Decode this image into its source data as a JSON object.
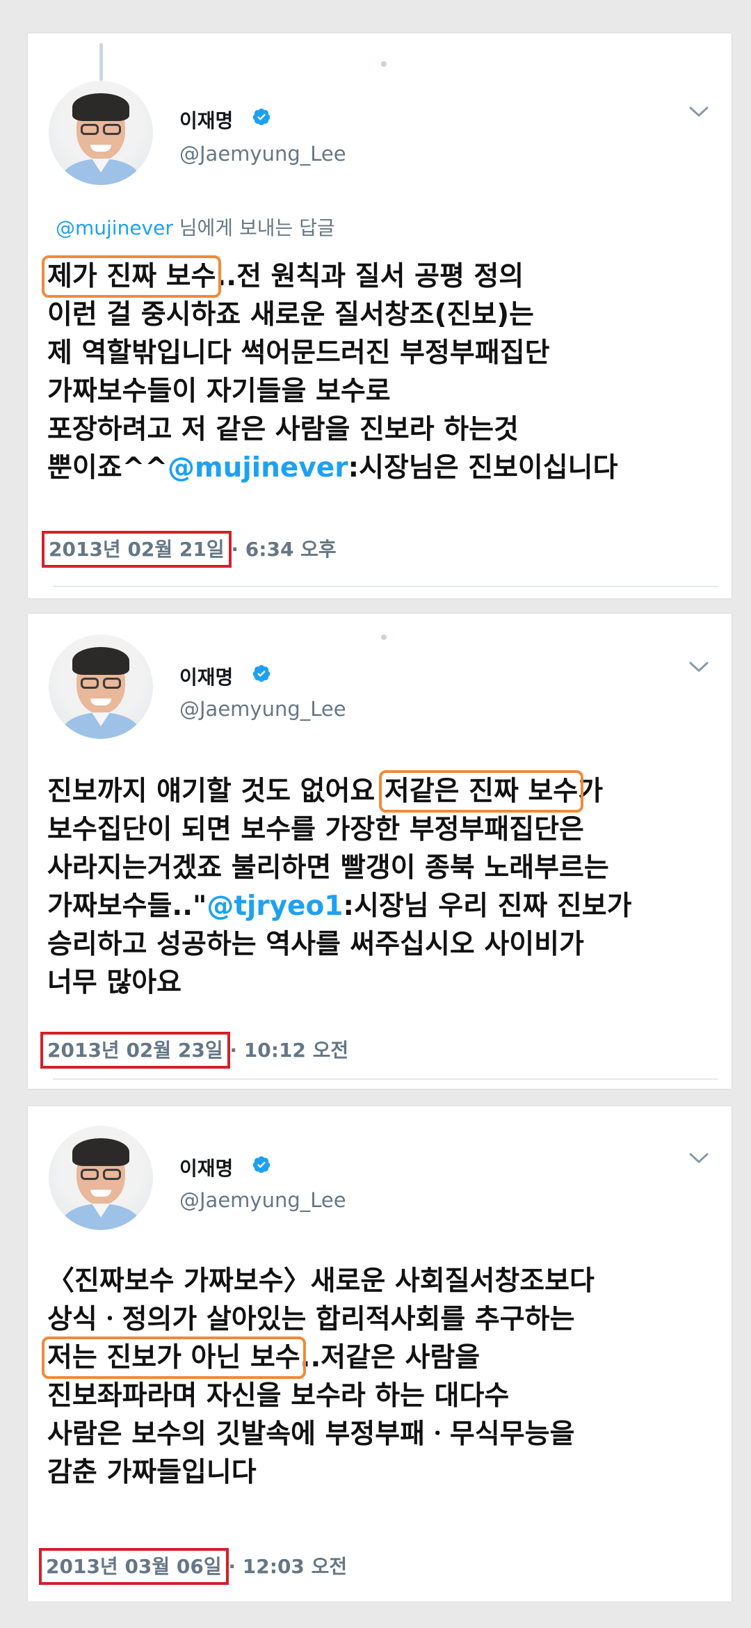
{
  "tweets": [
    {
      "name": "이재명",
      "handle": "@Jaemyung_Lee",
      "reply_user": "@mujinever",
      "reply_suffix": "님에게 보내는 답글",
      "lines": [
        {
          "hl": "제가 진짜 보수",
          "rest": "..전 원칙과 질서 공평 정의"
        },
        {
          "text": "이런 걸 중시하죠 새로운 질서창조(진보)는"
        },
        {
          "text": "제 역할밖입니다 썩어문드러진 부정부패집단"
        },
        {
          "text": "가짜보수들이 자기들을 보수로"
        },
        {
          "text": "포장하려고 저 같은 사람을 진보라 하는것"
        },
        {
          "pre": "뿐이죠^^",
          "link": "@mujinever",
          "post": ":시장님은 진보이십니다"
        }
      ],
      "date": "2013년 02월 21일",
      "time": "· 6:34 오후"
    },
    {
      "name": "이재명",
      "handle": "@Jaemyung_Lee",
      "lines": [
        {
          "pre": "진보까지 얘기할 것도 없어요 ",
          "hl": "저같은 진짜 보수",
          "post": "가"
        },
        {
          "text": "보수집단이 되면 보수를 가장한 부정부패집단은"
        },
        {
          "text": "사라지는거겠죠 불리하면 빨갱이 종북 노래부르는"
        },
        {
          "pre": "가짜보수들..\"",
          "link": "@tjryeo1",
          "post": ":시장님 우리 진짜 진보가"
        },
        {
          "text": "승리하고 성공하는 역사를 써주십시오 사이비가"
        },
        {
          "text": "너무 많아요"
        }
      ],
      "date": "2013년 02월 23일",
      "time": "· 10:12 오전"
    },
    {
      "name": "이재명",
      "handle": "@Jaemyung_Lee",
      "lines": [
        {
          "text": "〈진짜보수 가짜보수〉새로운 사회질서창조보다"
        },
        {
          "text": "상식ㆍ정의가 살아있는 합리적사회를 추구하는"
        },
        {
          "hl": "저는 진보가 아닌 보수",
          "rest": "..저같은 사람을"
        },
        {
          "text": "진보좌파라며 자신을 보수라 하는 대다수"
        },
        {
          "text": "사람은 보수의 깃발속에 부정부패ㆍ무식무능을"
        },
        {
          "text": "감춘 가짜들입니다"
        }
      ],
      "date": "2013년 03월 06일",
      "time": "· 12:03 오전"
    }
  ],
  "icons": {
    "verified": "verified-badge-icon",
    "chevron": "chevron-down-icon",
    "avatar": "profile-photo"
  },
  "colors": {
    "link": "#1da1f2",
    "verified": "#1da1f2",
    "highlight_orange": "#f08a3a",
    "highlight_red": "#d3202a"
  }
}
